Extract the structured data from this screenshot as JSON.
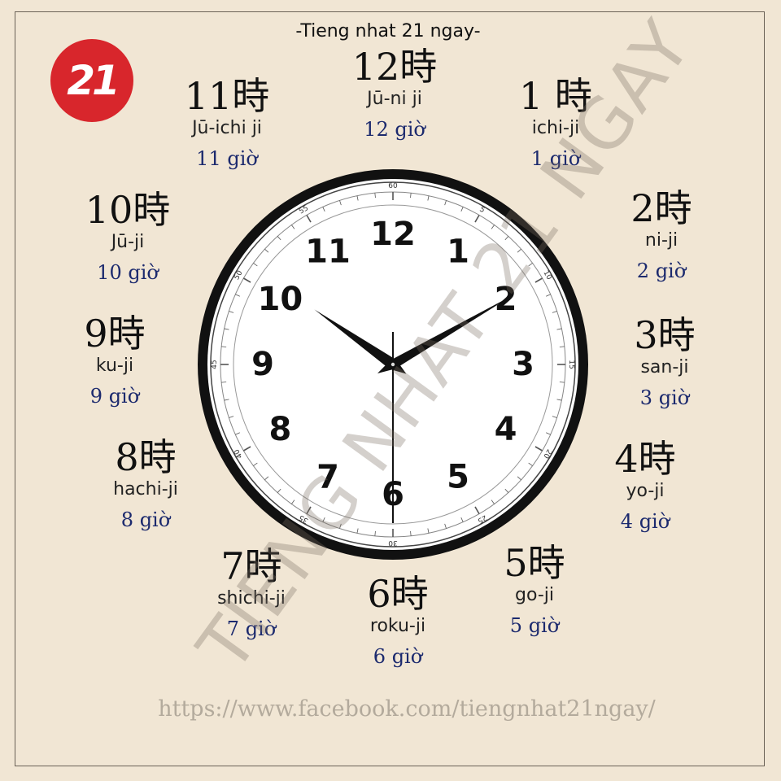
{
  "header": {
    "title": "-Tieng nhat 21 ngay-"
  },
  "logo": {
    "text": "21"
  },
  "hours": [
    {
      "kanji": "12時",
      "romaji": "Jū-ni ji",
      "viet": "12 giờ"
    },
    {
      "kanji": "1 時",
      "romaji": "ichi-ji",
      "viet": "1 giờ"
    },
    {
      "kanji": "2時",
      "romaji": "ni-ji",
      "viet": "2 giờ"
    },
    {
      "kanji": "3時",
      "romaji": "san-ji",
      "viet": "3 giờ"
    },
    {
      "kanji": "4時",
      "romaji": "yo-ji",
      "viet": "4 giờ"
    },
    {
      "kanji": "5時",
      "romaji": "go-ji",
      "viet": "5 giờ"
    },
    {
      "kanji": "6時",
      "romaji": "roku-ji",
      "viet": "6 giờ"
    },
    {
      "kanji": "7時",
      "romaji": "shichi-ji",
      "viet": "7 giờ"
    },
    {
      "kanji": "8時",
      "romaji": "hachi-ji",
      "viet": "8 giờ"
    },
    {
      "kanji": "9時",
      "romaji": "ku-ji",
      "viet": "9 giờ"
    },
    {
      "kanji": "10時",
      "romaji": "Jū-ji",
      "viet": "10 giờ"
    },
    {
      "kanji": "11時",
      "romaji": "Jū-ichi ji",
      "viet": "11 giờ"
    }
  ],
  "clock": {
    "numerals": [
      "12",
      "1",
      "2",
      "3",
      "4",
      "5",
      "6",
      "7",
      "8",
      "9",
      "10",
      "11"
    ],
    "minute_labels": [
      "60",
      "5",
      "10",
      "15",
      "20",
      "25",
      "30",
      "35",
      "40",
      "45",
      "50",
      "55"
    ],
    "time_shown": {
      "hour": 10,
      "minute": 10,
      "second": 30
    }
  },
  "watermark": {
    "text": "TIENG NHAT 21 NGAY"
  },
  "footer": {
    "url": "https://www.facebook.com/tiengnhat21ngay/"
  },
  "colors": {
    "background": "#f1e6d4",
    "logo": "#d8262c",
    "vietnamese_text": "#1c2a6e"
  }
}
